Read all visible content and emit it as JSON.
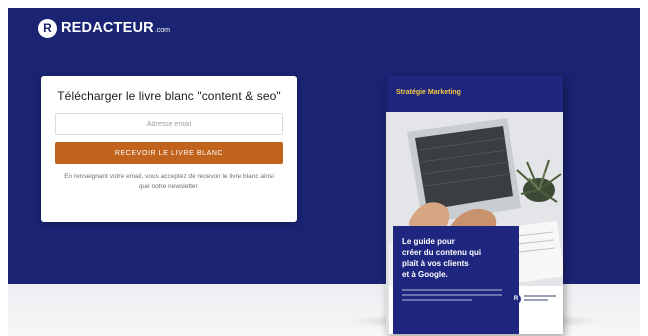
{
  "brand": {
    "mark": "R",
    "name": "REDACTEUR",
    "tld": ".com"
  },
  "form": {
    "title": "Télécharger le livre blanc \"content & seo\"",
    "email_placeholder": "Adresse email",
    "email_value": "",
    "submit_label": "RECEVOIR LE LIVRE BLANC",
    "disclaimer": "En renseignant votre email, vous acceptez de recevoir le livre blanc ainsi que notre newsletter."
  },
  "book": {
    "header_title": "Stratégie Marketing",
    "headline": "Le guide pour\ncréer du contenu qui\nplaît à vos clients\net à Google.",
    "badge_mark": "R"
  },
  "colors": {
    "hero_background": "#1a2472",
    "cta_background": "#c1631d",
    "book_navy": "#1e2680",
    "book_accent": "#f3c842"
  },
  "icons": {
    "logo": "redacteur-r-circle-icon",
    "book_badge": "redacteur-r-circle-icon"
  }
}
